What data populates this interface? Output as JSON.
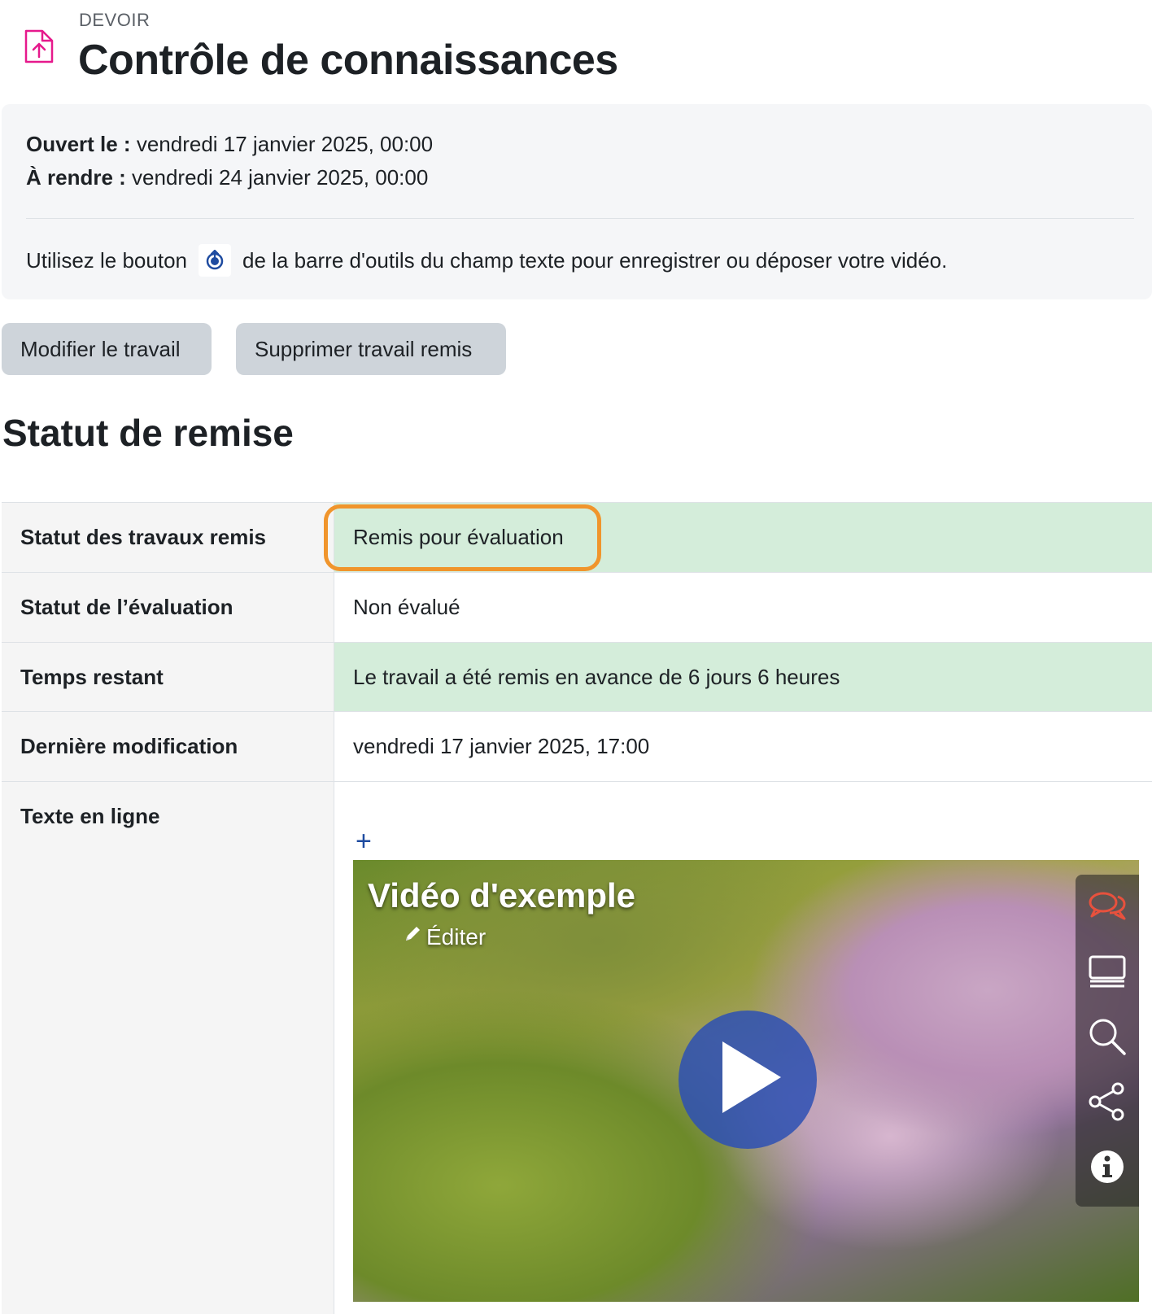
{
  "header": {
    "kicker": "DEVOIR",
    "title": "Contrôle de connaissances"
  },
  "dates": {
    "opened_label": "Ouvert le :",
    "opened_value": "vendredi 17 janvier 2025, 00:00",
    "due_label": "À rendre :",
    "due_value": "vendredi 24 janvier 2025, 00:00"
  },
  "hint": {
    "before": "Utilisez le bouton",
    "after": "de la barre d'outils du champ texte pour enregistrer ou déposer votre vidéo."
  },
  "actions": {
    "edit_label": "Modifier le travail",
    "delete_label": "Supprimer travail remis"
  },
  "section_title": "Statut de remise",
  "status_rows": [
    {
      "label": "Statut des travaux remis",
      "value": "Remis pour évaluation"
    },
    {
      "label": "Statut de l’évaluation",
      "value": "Non évalué"
    },
    {
      "label": "Temps restant",
      "value": "Le travail a été remis en avance de 6 jours 6 heures"
    },
    {
      "label": "Dernière modification",
      "value": "vendredi 17 janvier 2025, 17:00"
    },
    {
      "label": "Texte en ligne",
      "value": ""
    }
  ],
  "online_text": {
    "expand_symbol": "+",
    "video_title": "Vidéo d'exemple",
    "video_edit_label": "Éditer"
  },
  "colors": {
    "accent_icon": "#e6198c",
    "highlight_ring": "#f0952c",
    "success_bg": "#d4edda",
    "button_bg": "#ced4da",
    "link_blue": "#1e4ba0",
    "chat_icon": "#e8513d"
  },
  "icons": {
    "assignment": "file-upload-icon",
    "record": "record-upload-icon",
    "pencil": "pencil-icon",
    "play": "play-icon",
    "comments": "comments-icon",
    "transcript": "transcript-icon",
    "search": "search-icon",
    "share": "share-icon",
    "info": "info-icon"
  }
}
